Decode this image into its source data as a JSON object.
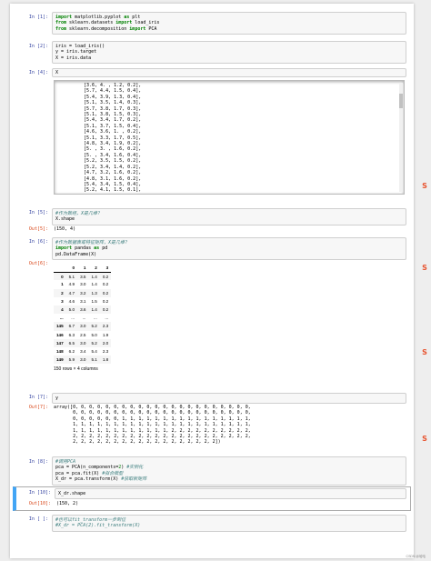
{
  "cells": [
    {
      "prompt": "In  [1]:",
      "lines": [
        [
          [
            "kw",
            "import"
          ],
          [
            "t",
            " matplotlib.pyplot "
          ],
          [
            "kw",
            "as"
          ],
          [
            "t",
            " plt"
          ]
        ],
        [
          [
            "kw",
            "from"
          ],
          [
            "t",
            " sklearn.datasets "
          ],
          [
            "kw",
            "import"
          ],
          [
            "t",
            " load_iris"
          ]
        ],
        [
          [
            "kw",
            "from"
          ],
          [
            "t",
            " sklearn.decomposition "
          ],
          [
            "kw",
            "import"
          ],
          [
            "t",
            " PCA"
          ]
        ]
      ]
    },
    {
      "prompt": "In  [2]:",
      "lines": [
        [
          [
            "t",
            "iris = load_iris()"
          ]
        ],
        [
          [
            "t",
            "y = iris.target"
          ]
        ],
        [
          [
            "t",
            "X = iris.data"
          ]
        ]
      ]
    },
    {
      "prompt": "In  [4]:",
      "lines": [
        [
          [
            "t",
            "X"
          ]
        ]
      ]
    },
    {
      "prompt": "In  [5]:",
      "lines": [
        [
          [
            "cm",
            "#作为数组，X是几维？"
          ]
        ],
        [
          [
            "t",
            "X.shape"
          ]
        ]
      ]
    },
    {
      "prompt": "In  [6]:",
      "lines": [
        [
          [
            "cm",
            "#作为数据表或特征矩阵，X是几维？"
          ]
        ],
        [
          [
            "kw",
            "import"
          ],
          [
            "t",
            " pandas "
          ],
          [
            "kw",
            "as"
          ],
          [
            "t",
            " pd"
          ]
        ],
        [
          [
            "t",
            "pd.DataFrame(X)"
          ]
        ]
      ]
    },
    {
      "prompt": "In  [7]:",
      "lines": [
        [
          [
            "t",
            "y"
          ]
        ]
      ]
    },
    {
      "prompt": "In  [8]:",
      "lines": [
        [
          [
            "cm",
            "#调用PCA"
          ]
        ],
        [
          [
            "t",
            "pca = PCA(n_components="
          ],
          [
            "num",
            "2"
          ],
          [
            "t",
            ") "
          ],
          [
            "cm",
            "#实例化"
          ]
        ],
        [
          [
            "t",
            "pca = pca.fit(X) "
          ],
          [
            "cm",
            "#拟合模型"
          ]
        ],
        [
          [
            "t",
            "X_dr = pca.transform(X) "
          ],
          [
            "cm",
            "#获取新矩阵"
          ]
        ]
      ]
    },
    {
      "prompt": "In [10]:",
      "lines": [
        [
          [
            "t",
            "X_dr.shape"
          ]
        ]
      ]
    },
    {
      "prompt": "In  [ ]:",
      "lines": [
        [
          [
            "cm",
            "#也可以fit_transform一步到位"
          ]
        ],
        [
          [
            "cm",
            "#X_dr = PCA(2).fit_transform(X)"
          ]
        ]
      ]
    }
  ],
  "outputs": {
    "x_array": [
      "[3.6, 4. , 1.2, 0.2],",
      "[5.7, 4.4, 1.5, 0.4],",
      "[5.4, 3.9, 1.3, 0.4],",
      "[5.1, 3.5, 1.4, 0.3],",
      "[5.7, 3.8, 1.7, 0.3],",
      "[5.1, 3.8, 1.5, 0.3],",
      "[5.4, 3.4, 1.7, 0.2],",
      "[5.1, 3.7, 1.5, 0.4],",
      "[4.6, 3.6, 1. , 0.2],",
      "[5.1, 3.3, 1.7, 0.5],",
      "[4.8, 3.4, 1.9, 0.2],",
      "[5. , 3. , 1.6, 0.2],",
      "[5. , 3.4, 1.6, 0.4],",
      "[5.2, 3.5, 1.5, 0.2],",
      "[5.2, 3.4, 1.4, 0.2],",
      "[4.7, 3.2, 1.6, 0.2],",
      "[4.8, 3.1, 1.6, 0.2],",
      "[5.4, 3.4, 1.5, 0.4],",
      "[5.2, 4.1, 1.5, 0.1],"
    ],
    "shape_prompt": "Out[5]:",
    "shape_text": "(150, 4)",
    "df_prompt": "Out[6]:",
    "df_columns": [
      "",
      "0",
      "1",
      "2",
      "3"
    ],
    "df_rows": [
      [
        "0",
        "5.1",
        "3.5",
        "1.4",
        "0.2"
      ],
      [
        "1",
        "4.9",
        "3.0",
        "1.4",
        "0.2"
      ],
      [
        "2",
        "4.7",
        "3.2",
        "1.3",
        "0.2"
      ],
      [
        "3",
        "4.6",
        "3.1",
        "1.5",
        "0.2"
      ],
      [
        "4",
        "5.0",
        "3.6",
        "1.4",
        "0.2"
      ],
      [
        "...",
        "...",
        "...",
        "...",
        "..."
      ],
      [
        "145",
        "6.7",
        "3.0",
        "5.2",
        "2.3"
      ],
      [
        "146",
        "6.3",
        "2.5",
        "5.0",
        "1.9"
      ],
      [
        "147",
        "6.5",
        "3.0",
        "5.2",
        "2.0"
      ],
      [
        "148",
        "6.2",
        "3.4",
        "5.4",
        "2.3"
      ],
      [
        "149",
        "5.9",
        "3.0",
        "5.1",
        "1.8"
      ]
    ],
    "df_shape": "150 rows × 4 columns",
    "y_prompt": "Out[7]:",
    "y_lines": [
      "array([0, 0, 0, 0, 0, 0, 0, 0, 0, 0, 0, 0, 0, 0, 0, 0, 0, 0, 0, 0, 0, 0,",
      "       0, 0, 0, 0, 0, 0, 0, 0, 0, 0, 0, 0, 0, 0, 0, 0, 0, 0, 0, 0, 0, 0,",
      "       0, 0, 0, 0, 0, 0, 1, 1, 1, 1, 1, 1, 1, 1, 1, 1, 1, 1, 1, 1, 1, 1,",
      "       1, 1, 1, 1, 1, 1, 1, 1, 1, 1, 1, 1, 1, 1, 1, 1, 1, 1, 1, 1, 1, 1,",
      "       1, 1, 1, 1, 1, 1, 1, 1, 1, 1, 1, 1, 2, 2, 2, 2, 2, 2, 2, 2, 2, 2,",
      "       2, 2, 2, 2, 2, 2, 2, 2, 2, 2, 2, 2, 2, 2, 2, 2, 2, 2, 2, 2, 2, 2,",
      "       2, 2, 2, 2, 2, 2, 2, 2, 2, 2, 2, 2, 2, 2, 2, 2, 2, 2])"
    ],
    "dr_prompt": "Out[10]:",
    "dr_text": "(150, 2)"
  },
  "side_icons": [
    "S",
    "S",
    "S",
    "S"
  ],
  "watermark": "CSDN @哈哈",
  "colors": {
    "selected_bar": "#42a5f5",
    "in_prompt": "#303f9f",
    "out_prompt": "#d84315",
    "side_icon": "#e8532f"
  }
}
